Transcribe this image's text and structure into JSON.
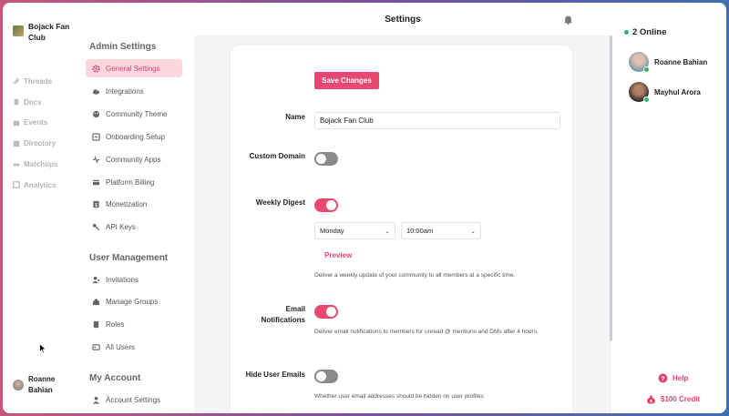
{
  "app": {
    "org_name": "Bojack Fan Club",
    "current_user": "Roanne Bahian"
  },
  "left_nav": {
    "items": [
      {
        "label": "Threads",
        "icon": "threads-icon"
      },
      {
        "label": "Docs",
        "icon": "docs-icon"
      },
      {
        "label": "Events",
        "icon": "events-icon"
      },
      {
        "label": "Directory",
        "icon": "directory-icon"
      },
      {
        "label": "Matchups",
        "icon": "matchups-icon"
      },
      {
        "label": "Analytics",
        "icon": "analytics-icon"
      }
    ]
  },
  "settings_nav": {
    "admin_title": "Admin Settings",
    "admin_items": [
      {
        "label": "General Settings",
        "icon": "gear-icon",
        "active": true
      },
      {
        "label": "Integrations",
        "icon": "cloud-icon"
      },
      {
        "label": "Community Theme",
        "icon": "palette-icon"
      },
      {
        "label": "Onboarding Setup",
        "icon": "onboarding-icon"
      },
      {
        "label": "Community Apps",
        "icon": "apps-icon"
      },
      {
        "label": "Platform Billing",
        "icon": "billing-icon"
      },
      {
        "label": "Monetization",
        "icon": "monetization-icon"
      },
      {
        "label": "API Keys",
        "icon": "key-icon"
      }
    ],
    "user_mgmt_title": "User Management",
    "user_mgmt_items": [
      {
        "label": "Invitations",
        "icon": "invite-icon"
      },
      {
        "label": "Manage Groups",
        "icon": "groups-icon"
      },
      {
        "label": "Roles",
        "icon": "roles-icon"
      },
      {
        "label": "All Users",
        "icon": "users-icon"
      }
    ],
    "account_title": "My Account",
    "account_items": [
      {
        "label": "Account Settings",
        "icon": "account-icon"
      }
    ]
  },
  "main": {
    "title": "Settings",
    "save_label": "Save Changes",
    "name_label": "Name",
    "name_value": "Bojack Fan Club",
    "custom_domain_label": "Custom Domain",
    "custom_domain_enabled": false,
    "weekly_digest_label": "Weekly Digest",
    "weekly_digest_enabled": true,
    "digest_day": "Monday",
    "digest_time": "10:00am",
    "preview_label": "Preview",
    "digest_desc": "Deliver a weekly update of your community to all members at a specific time.",
    "email_notif_label_1": "Email",
    "email_notif_label_2": "Notifications",
    "email_notif_enabled": true,
    "email_notif_desc": "Deliver email notifications to members for unread @ mentions and DMs after 4 hours.",
    "hide_emails_label": "Hide User Emails",
    "hide_emails_enabled": false,
    "hide_emails_desc": "Whether user email addresses should be hidden on user profiles"
  },
  "right_panel": {
    "online_label": "2 Online",
    "members": [
      {
        "name": "Roanne Bahian"
      },
      {
        "name": "Mayhul Arora"
      }
    ],
    "help_label": "Help",
    "credit_label": "$100 Credit"
  },
  "colors": {
    "accent": "#e8476f",
    "online": "#2fb86a"
  }
}
